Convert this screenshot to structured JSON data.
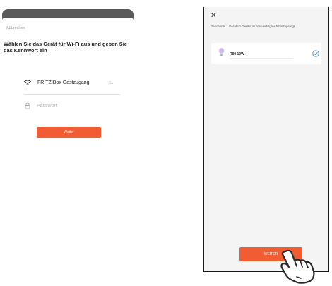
{
  "left": {
    "cancel_label": "Abbrechen",
    "title": "Wählen Sie das Gerät für Wi-Fi aus und geben Sie das Kennwort ein",
    "wifi": {
      "icon": "wifi-icon",
      "ssid": "FRITZ!Box Gastzugang",
      "switch_icon": "swap-icon",
      "switch_glyph": "⇆"
    },
    "password": {
      "icon": "lock-icon",
      "placeholder": "Passwort",
      "value": ""
    },
    "next_label": "Weiter"
  },
  "right": {
    "close_icon": "close-icon",
    "close_glyph": "✕",
    "status": "Gescannte 1 Geräte,1 Geräte wurden erfolgreich hinzugefügt",
    "devices": [
      {
        "name": "R80 10W",
        "icon": "bulb-icon",
        "selected": true
      }
    ],
    "next_label": "WEITER"
  },
  "colors": {
    "accent": "#f25c32",
    "check_blue": "#3a8fd6",
    "right_bg": "#f4f4f4"
  }
}
